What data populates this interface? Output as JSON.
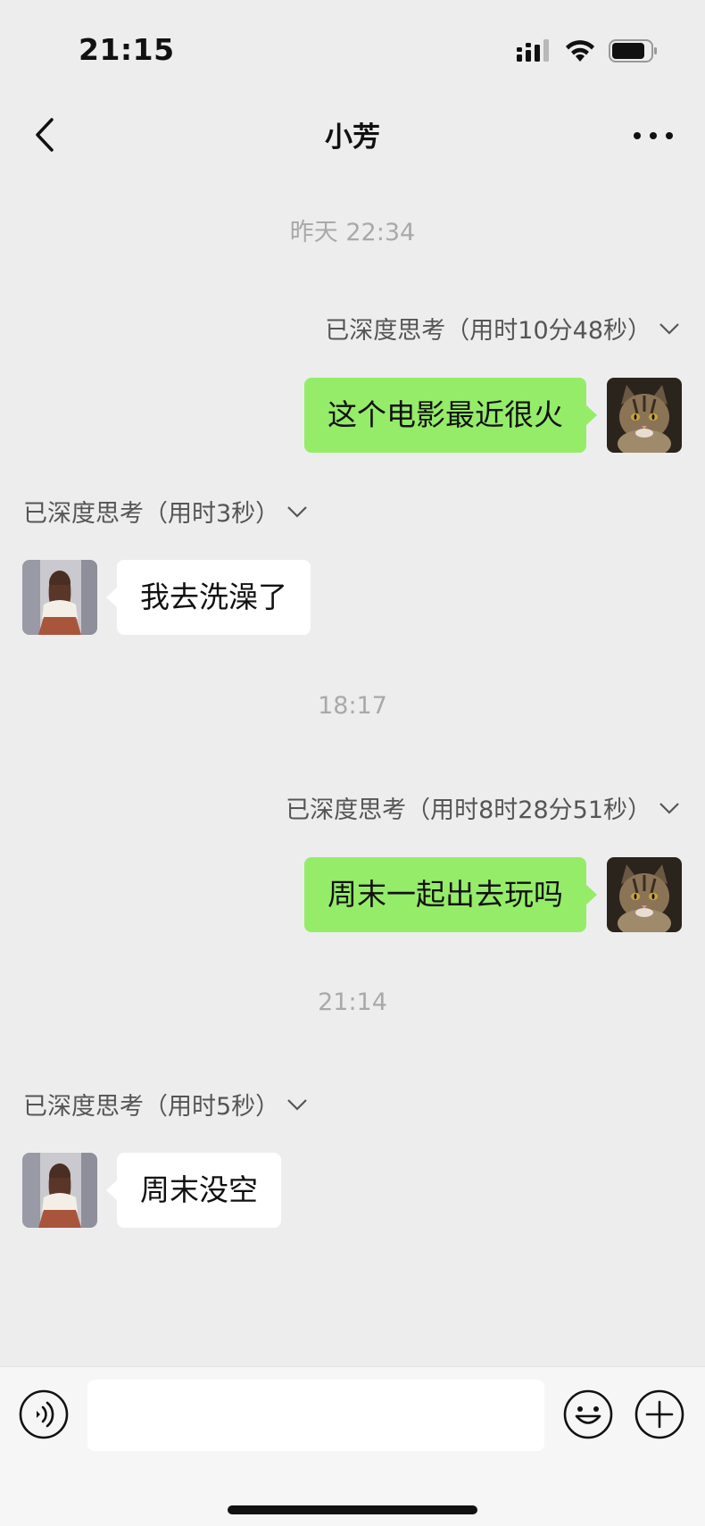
{
  "status_bar": {
    "time": "21:15"
  },
  "header": {
    "title": "小芳"
  },
  "messages": [
    {
      "type": "time",
      "text": "昨天 22:34"
    },
    {
      "type": "think",
      "side": "right",
      "text": "已深度思考（用时10分48秒）"
    },
    {
      "type": "bubble",
      "side": "right",
      "text": "这个电影最近很火"
    },
    {
      "type": "think",
      "side": "left",
      "text": "已深度思考（用时3秒）"
    },
    {
      "type": "bubble",
      "side": "left",
      "text": "我去洗澡了"
    },
    {
      "type": "time",
      "text": "18:17"
    },
    {
      "type": "think",
      "side": "right",
      "text": "已深度思考（用时8时28分51秒）"
    },
    {
      "type": "bubble",
      "side": "right",
      "text": "周末一起出去玩吗"
    },
    {
      "type": "time",
      "text": "21:14"
    },
    {
      "type": "think",
      "side": "left",
      "text": "已深度思考（用时5秒）"
    },
    {
      "type": "bubble",
      "side": "left",
      "text": "周末没空"
    }
  ],
  "input": {
    "value": ""
  },
  "icons": {
    "back": "chevron-left-icon",
    "more": "more-dots-icon",
    "voice": "voice-icon",
    "emoji": "emoji-icon",
    "plus": "plus-icon"
  },
  "colors": {
    "background": "#ededed",
    "my_bubble": "#95ec69",
    "their_bubble": "#ffffff",
    "timestamp": "#a9a9a9"
  }
}
